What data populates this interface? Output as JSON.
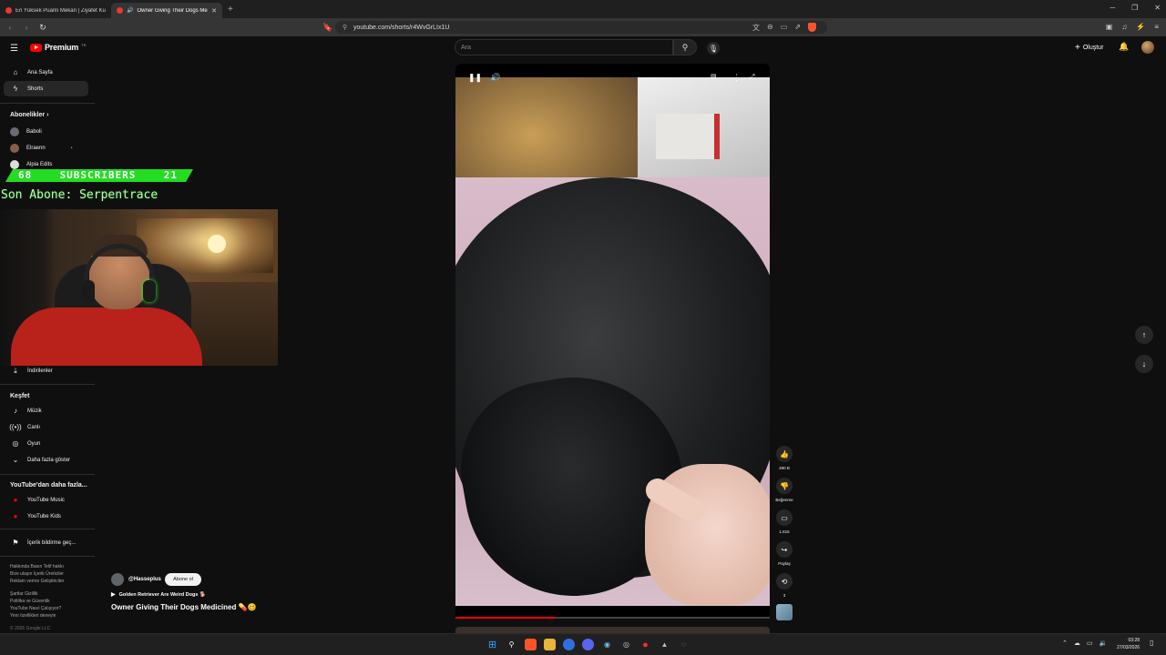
{
  "browser": {
    "tabs": [
      {
        "title": "En Yüksek Puanlı Mekan | Ziyafet Ku",
        "active": false
      },
      {
        "title": "Owner Giving Their Dogs Me",
        "active": true
      }
    ],
    "url": "youtube.com/shorts/r4WvGrLIx1U"
  },
  "header": {
    "logo_text": "Premium",
    "logo_region": "TR",
    "search_placeholder": "Ara",
    "create_label": "Oluştur"
  },
  "sidebar": {
    "home": "Ana Sayfa",
    "shorts": "Shorts",
    "subscriptions_heading": "Abonelikler",
    "subscriptions": [
      {
        "name": "Baboli"
      },
      {
        "name": "Elraenn"
      },
      {
        "name": "Alpia Edits"
      }
    ],
    "downloads": "İndirilenler",
    "explore_heading": "Keşfet",
    "explore": [
      "Müzik",
      "Canlı",
      "Oyun",
      "Daha fazla göster"
    ],
    "more_heading": "YouTube'dan daha fazla...",
    "more": [
      "YouTube Music",
      "YouTube Kids"
    ],
    "report": "İçerik bildirme geç...",
    "footer": [
      "Hakkında  Basın  Telif hakkı",
      "Bize ulaşın  İçerik Üreticiler",
      "Reklam verme  Geliştiriciler",
      "",
      "Şartlar  Gizlilik",
      "Politika ve Güvenlik",
      "YouTube Nasıl Çalışıyor?",
      "Yeni özellikleri deneyin",
      "",
      "© 2026 Google LLC"
    ]
  },
  "overlay": {
    "subs_left": "68",
    "subs_label": "SUBSCRIBERS",
    "subs_right": "21",
    "last_sub": "Son Abone: Serpentrace"
  },
  "short": {
    "channel": "@Hasseplus",
    "subscribe_label": "Abone ol",
    "song": "Golden Retriever Are Weird Dogs 🐕",
    "title": "Owner Giving Their Dogs Medicined 💊🥴",
    "progress": 0.32
  },
  "actions": {
    "likes": "490 B",
    "dislike_label": "Beğenme",
    "comments": "1.615",
    "share_label": "Paylaş",
    "remix_count": "3"
  },
  "taskbar": {
    "time": "03:28",
    "date": "27/03/2026"
  },
  "colors": {
    "accent": "#ff0000",
    "overlay_green": "#22dd22"
  }
}
